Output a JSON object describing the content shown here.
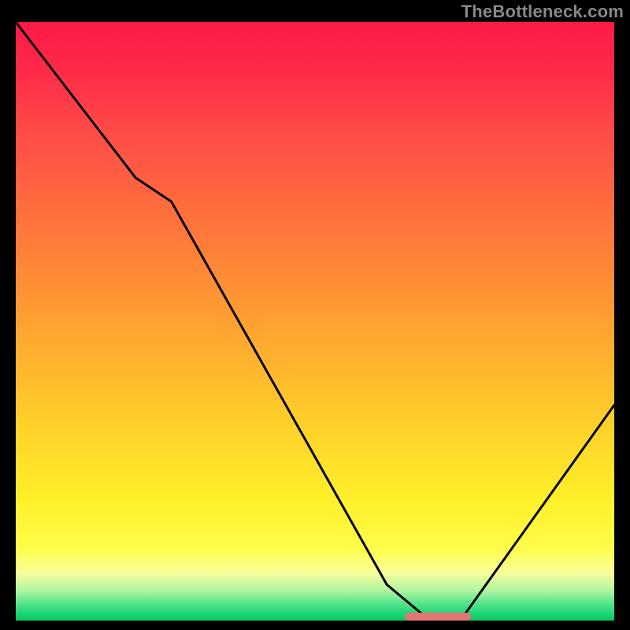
{
  "watermark": "TheBottleneck.com",
  "colors": {
    "gradient_top": "#ff1a46",
    "gradient_mid": "#ffd22a",
    "gradient_bottom": "#0ac95e",
    "curve": "#000000",
    "marker": "#e57373",
    "axis": "#000000"
  },
  "chart_data": {
    "type": "line",
    "title": "",
    "xlabel": "",
    "ylabel": "",
    "xlim": [
      0,
      100
    ],
    "ylim": [
      0,
      100
    ],
    "grid": false,
    "x": [
      0,
      20,
      26,
      62,
      68,
      75,
      100
    ],
    "values": [
      100,
      74,
      70,
      6,
      1,
      1,
      36
    ],
    "description": "V-shaped bottleneck curve over rainbow gradient; minimum flat region near x≈68–75",
    "marker": {
      "x_start": 65,
      "x_end": 76,
      "y": 0.6
    }
  }
}
